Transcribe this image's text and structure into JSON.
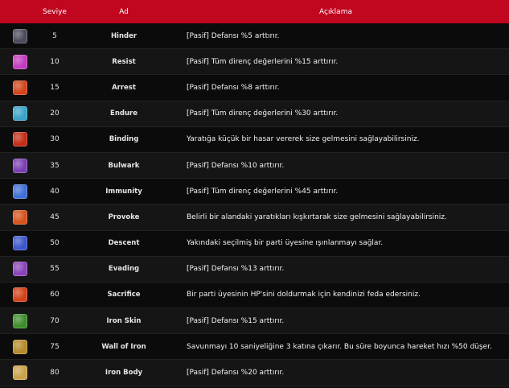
{
  "header": {
    "level": "Seviye",
    "name": "Ad",
    "desc": "Açıklama"
  },
  "rows": [
    {
      "icon": "shield-icon",
      "color": "#4a4a5a",
      "level": "5",
      "name": "Hinder",
      "desc": "[Pasif] Defansı %5 arttırır."
    },
    {
      "icon": "magic-swirl-icon",
      "color": "#c23bbf",
      "level": "10",
      "name": "Resist",
      "desc": "[Pasif] Tüm direnç değerlerini %15 arttırır."
    },
    {
      "icon": "flame-icon",
      "color": "#d0451a",
      "level": "15",
      "name": "Arrest",
      "desc": "[Pasif] Defansı %8 arttırır."
    },
    {
      "icon": "magic-swirl-icon",
      "color": "#3aa3c7",
      "level": "20",
      "name": "Endure",
      "desc": "[Pasif] Tüm direnç değerlerini %30 arttırır."
    },
    {
      "icon": "dragon-icon",
      "color": "#c32c16",
      "level": "30",
      "name": "Binding",
      "desc": "Yaratığa küçük bir hasar vererek size gelmesini sağlayabilirsiniz."
    },
    {
      "icon": "shield-icon",
      "color": "#7a3fb0",
      "level": "35",
      "name": "Bulwark",
      "desc": "[Pasif] Defansı %10 arttırır."
    },
    {
      "icon": "magic-swirl-icon",
      "color": "#3f6fd6",
      "level": "40",
      "name": "Immunity",
      "desc": "[Pasif] Tüm direnç değerlerini %45 arttırır."
    },
    {
      "icon": "dragon-icon",
      "color": "#d4531c",
      "level": "45",
      "name": "Provoke",
      "desc": "Belirli bir alandaki yaratıkları kışkırtarak size gelmesini sağlayabilirsiniz."
    },
    {
      "icon": "wing-icon",
      "color": "#3c55c9",
      "level": "50",
      "name": "Descent",
      "desc": "Yakındaki seçilmiş bir parti üyesine ışınlanmayı sağlar."
    },
    {
      "icon": "shield-icon",
      "color": "#8a42b8",
      "level": "55",
      "name": "Evading",
      "desc": "[Pasif] Defansı %13 arttırır."
    },
    {
      "icon": "flag-icon",
      "color": "#d2421a",
      "level": "60",
      "name": "Sacrifice",
      "desc": "Bir parti üyesinin HP'sini doldurmak için kendinizi feda edersiniz."
    },
    {
      "icon": "armor-icon",
      "color": "#3d8b2a",
      "level": "70",
      "name": "Iron Skin",
      "desc": "[Pasif] Defansı %15 arttırır."
    },
    {
      "icon": "wall-icon",
      "color": "#b48a2a",
      "level": "75",
      "name": "Wall of Iron",
      "desc": "Savunmayı 10 saniyeliğine 3 katına çıkarır. Bu süre boyunca hareket hızı %50 düşer."
    },
    {
      "icon": "armor-icon",
      "color": "#c9a24a",
      "level": "80",
      "name": "Iron Body",
      "desc": "[Pasif] Defansı %20 arttırır."
    }
  ]
}
